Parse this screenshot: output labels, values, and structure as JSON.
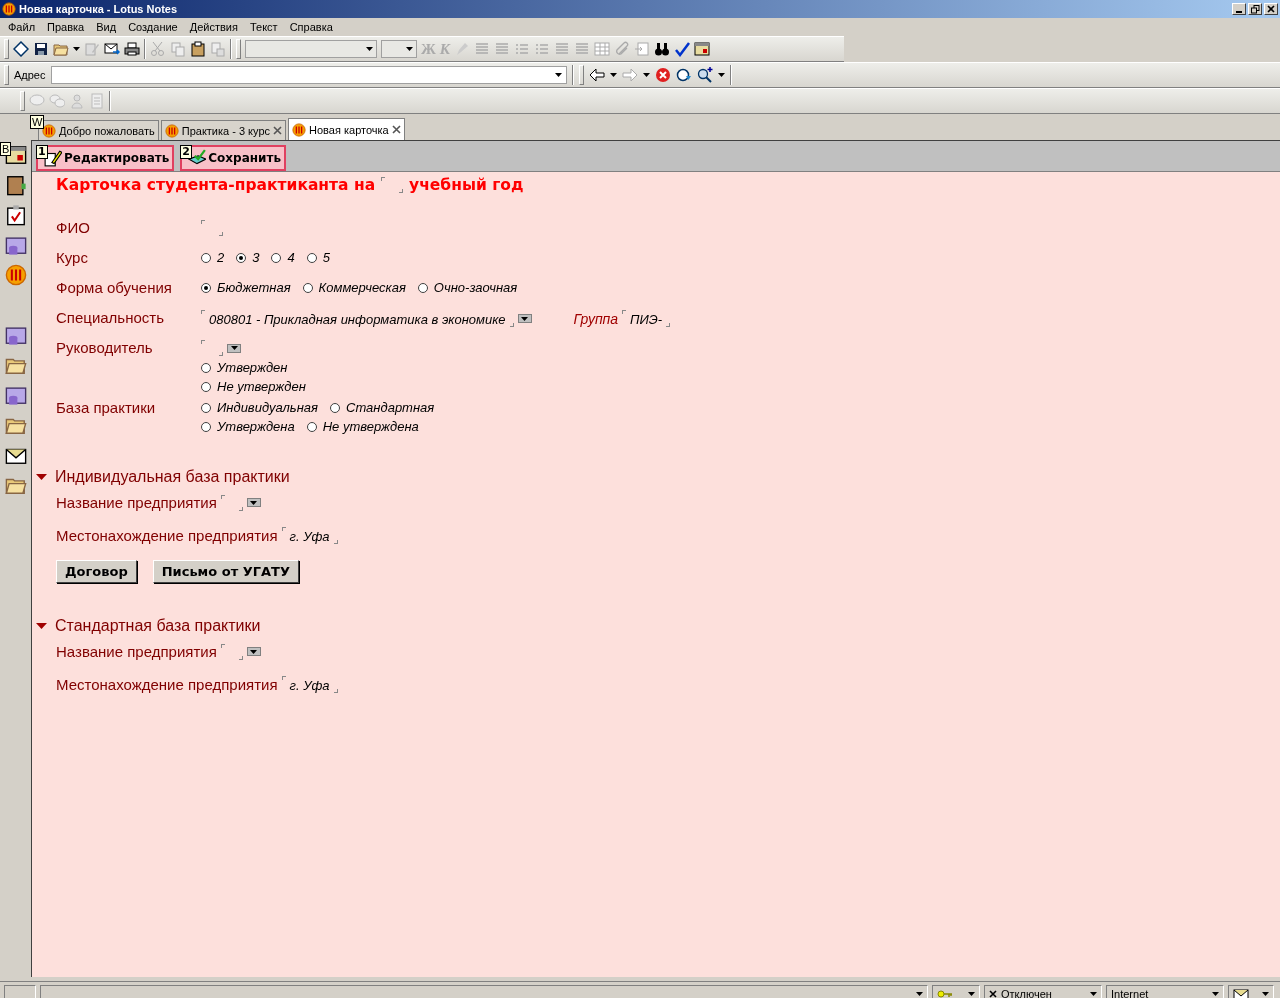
{
  "window": {
    "title": "Новая карточка - Lotus Notes"
  },
  "menu": [
    "Файл",
    "Правка",
    "Вид",
    "Создание",
    "Действия",
    "Текст",
    "Справка"
  ],
  "toolbar": {
    "bold_key": "Ж",
    "italic_key": "К"
  },
  "address": {
    "label": "Адрес"
  },
  "tabs_hotkey": "W",
  "tabs": [
    {
      "label": "Добро пожаловать",
      "selected": false,
      "closable": false
    },
    {
      "label": "Практика - 3 курс",
      "selected": false,
      "closable": true
    },
    {
      "label": "Новая карточка",
      "selected": true,
      "closable": true
    }
  ],
  "sidebar_hotkey": "B",
  "actions": [
    {
      "hotkey": "1",
      "label": "Редактировать"
    },
    {
      "hotkey": "2",
      "label": "Сохранить"
    }
  ],
  "form": {
    "title_before": "Карточка студента-практиканта на",
    "title_after": "учебный год",
    "rows": [
      {
        "kind": "text",
        "label": "ФИО"
      },
      {
        "kind": "radio",
        "label": "Курс",
        "lines": [
          [
            {
              "label": "2",
              "selected": false
            },
            {
              "label": "3",
              "selected": true
            },
            {
              "label": "4",
              "selected": false
            },
            {
              "label": "5",
              "selected": false
            }
          ]
        ]
      },
      {
        "kind": "radio",
        "label": "Форма обучения",
        "lines": [
          [
            {
              "label": "Бюджетная",
              "selected": true
            },
            {
              "label": "Коммерческая",
              "selected": false
            },
            {
              "label": "Очно-заочная",
              "selected": false
            }
          ]
        ]
      },
      {
        "kind": "dropdown",
        "label": "Специальность",
        "value": "080801 - Прикладная информатика в экономике",
        "extra_label": "Группа",
        "extra_value": "ПИЭ-"
      },
      {
        "kind": "dropdown",
        "label": "Руководитель",
        "lines": [
          [
            {
              "label": "Утвержден",
              "selected": false
            }
          ],
          [
            {
              "label": "Не утвержден",
              "selected": false
            }
          ]
        ]
      },
      {
        "kind": "radio",
        "label": "База практики",
        "lines": [
          [
            {
              "label": "Индивидуальная",
              "selected": false
            },
            {
              "label": "Стандартная",
              "selected": false
            }
          ],
          [
            {
              "label": "Утверждена",
              "selected": false
            },
            {
              "label": "Не утверждена",
              "selected": false
            }
          ]
        ]
      }
    ],
    "sections": [
      {
        "title": "Индивидуальная база практики",
        "expanded": true,
        "rows": [
          {
            "kind": "dropdown",
            "label": "Название предприятия"
          },
          {
            "kind": "text",
            "label": "Местонахождение предприятия",
            "value": "г. Уфа"
          }
        ],
        "buttons": [
          "Договор",
          "Письмо от УГАТУ"
        ]
      },
      {
        "title": "Стандартная база практики",
        "expanded": true,
        "rows": [
          {
            "kind": "dropdown",
            "label": "Название предприятия"
          },
          {
            "kind": "text",
            "label": "Местонахождение предприятия",
            "value": "г. Уфа"
          }
        ]
      }
    ]
  },
  "status_bar": {
    "connection": "Отключен",
    "location": "Internet"
  }
}
